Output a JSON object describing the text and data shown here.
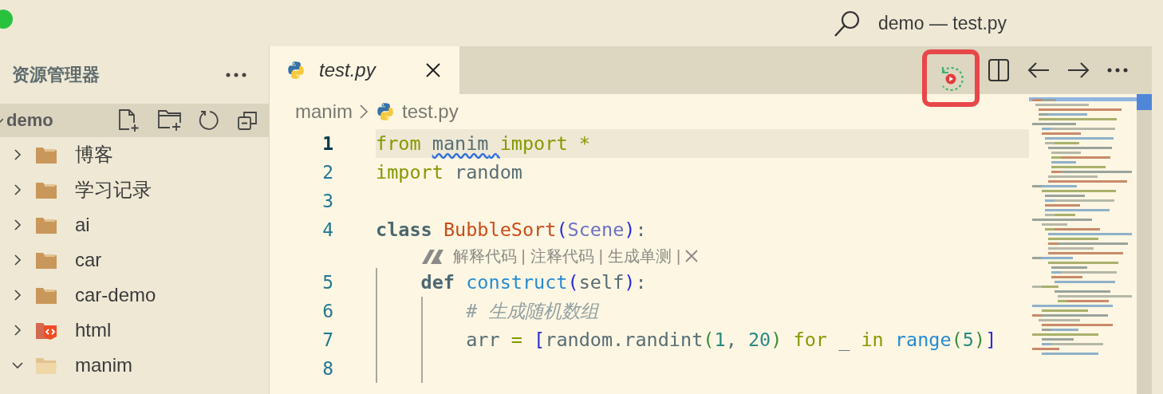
{
  "window": {
    "title": "demo — test.py"
  },
  "sidebar": {
    "title": "资源管理器",
    "root": {
      "label": "demo",
      "expanded": true,
      "children": [
        {
          "label": "博客",
          "kind": "folder",
          "expanded": false
        },
        {
          "label": "学习记录",
          "kind": "folder",
          "expanded": false
        },
        {
          "label": "ai",
          "kind": "folder",
          "expanded": false
        },
        {
          "label": "car",
          "kind": "folder",
          "expanded": false
        },
        {
          "label": "car-demo",
          "kind": "folder",
          "expanded": false
        },
        {
          "label": "html",
          "kind": "html-folder",
          "expanded": false
        },
        {
          "label": "manim",
          "kind": "folder",
          "expanded": true
        }
      ]
    }
  },
  "editor": {
    "tabs": [
      {
        "label": "test.py",
        "selected": true,
        "preview": true
      }
    ],
    "breadcrumb": [
      {
        "label": "manim",
        "kind": "folder"
      },
      {
        "label": "test.py",
        "kind": "python"
      }
    ],
    "lines": [
      {
        "kind": "code",
        "number": "1",
        "current": true,
        "tokens": [
          {
            "t": "from",
            "kind": "keyword",
            "space": true
          },
          {
            "t": "manim",
            "kind": "plain",
            "squiggle": true,
            "space": true
          },
          {
            "t": "import",
            "kind": "keyword",
            "space": true
          },
          {
            "t": "*",
            "kind": "keyword"
          }
        ]
      },
      {
        "kind": "code",
        "number": "2",
        "current": false,
        "tokens": [
          {
            "t": "import",
            "kind": "keyword",
            "space": true
          },
          {
            "t": "random",
            "kind": "plain"
          }
        ]
      },
      {
        "kind": "code",
        "number": "3",
        "current": false
      },
      {
        "kind": "code",
        "number": "4",
        "current": false,
        "tokens": [
          {
            "t": "class",
            "kind": "storage",
            "space": true
          },
          {
            "t": "BubbleSort",
            "kind": "classname"
          },
          {
            "t": "(",
            "kind": "bracket"
          },
          {
            "t": "Scene",
            "kind": "inherited"
          },
          {
            "t": ")",
            "kind": "bracket"
          },
          {
            "t": ":",
            "kind": "plain"
          }
        ],
        "children": [
          {
            "kind": "codelens",
            "actions": [
              "解释代码",
              "注释代码",
              "生成单测"
            ],
            "separator": "|"
          },
          {
            "kind": "code",
            "number": "5",
            "current": false,
            "tokens": [
              {
                "t": "def",
                "kind": "storage",
                "space": true
              },
              {
                "t": "construct",
                "kind": "function"
              },
              {
                "t": "(",
                "kind": "bracket"
              },
              {
                "t": "self",
                "kind": "plain"
              },
              {
                "t": ")",
                "kind": "bracket"
              },
              {
                "t": ":",
                "kind": "plain"
              }
            ],
            "children": [
              {
                "kind": "code",
                "number": "6",
                "current": false,
                "tokens": [
                  {
                    "t": "# 生成随机数组",
                    "kind": "comment"
                  }
                ]
              },
              {
                "kind": "code",
                "number": "7",
                "current": false,
                "tokens": [
                  {
                    "t": "arr",
                    "kind": "plain",
                    "space": true
                  },
                  {
                    "t": "=",
                    "kind": "keyword",
                    "space": true
                  },
                  {
                    "t": "[",
                    "kind": "bracket"
                  },
                  {
                    "t": "random.randint",
                    "kind": "plain"
                  },
                  {
                    "t": "(",
                    "kind": "bracket2"
                  },
                  {
                    "t": "1",
                    "kind": "number"
                  },
                  {
                    "t": ",",
                    "kind": "plain",
                    "space": true
                  },
                  {
                    "t": "20",
                    "kind": "number"
                  },
                  {
                    "t": ")",
                    "kind": "bracket2",
                    "space": true
                  },
                  {
                    "t": "for",
                    "kind": "keyword",
                    "space": true
                  },
                  {
                    "t": "_",
                    "kind": "plain",
                    "space": true
                  },
                  {
                    "t": "in",
                    "kind": "keyword",
                    "space": true
                  },
                  {
                    "t": "range",
                    "kind": "function"
                  },
                  {
                    "t": "(",
                    "kind": "bracket2"
                  },
                  {
                    "t": "5",
                    "kind": "number"
                  },
                  {
                    "t": ")",
                    "kind": "bracket2"
                  },
                  {
                    "t": "]",
                    "kind": "bracket"
                  }
                ]
              },
              {
                "kind": "code",
                "number": "8",
                "current": false
              }
            ]
          }
        ]
      }
    ]
  }
}
